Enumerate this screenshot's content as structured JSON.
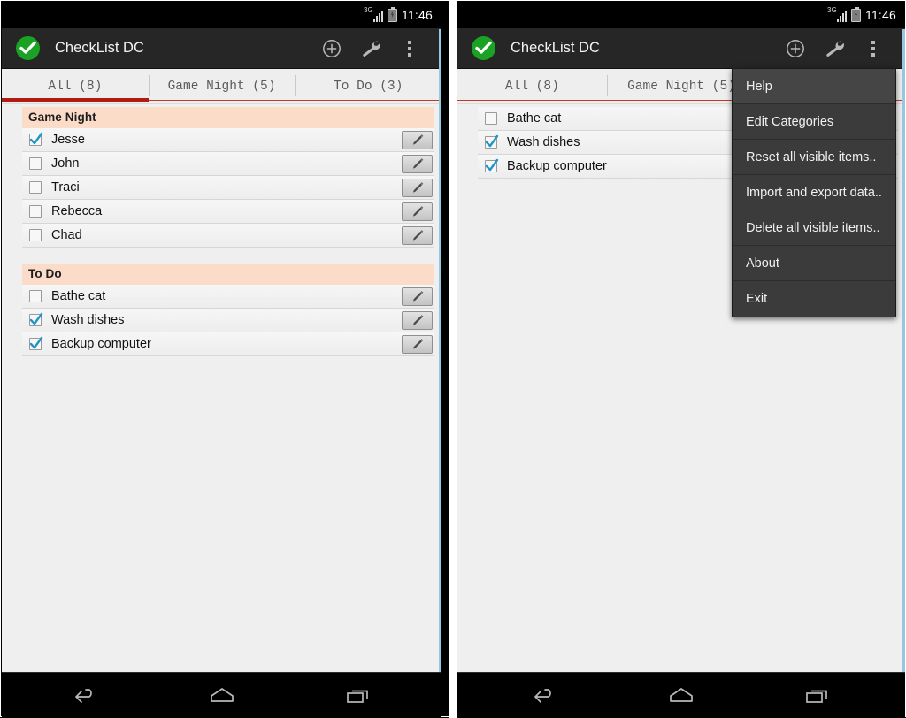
{
  "status_bar": {
    "network_label": "3G",
    "time": "11:46",
    "signal_icon": "signal-bars-icon",
    "battery_icon": "battery-charging-icon"
  },
  "action_bar": {
    "app_icon": "green-check-circle-icon",
    "title": "CheckList DC",
    "add_icon": "plus-circle-icon",
    "settings_icon": "wrench-icon",
    "overflow_icon": "three-dots-icon"
  },
  "tabs": [
    {
      "label": "All (8)",
      "active": true
    },
    {
      "label": "Game Night (5)",
      "active": false
    },
    {
      "label": "To Do (3)",
      "active": false
    }
  ],
  "tabs_right": [
    {
      "label": "All (8)",
      "active": false
    },
    {
      "label": "Game Night (5)",
      "active": false
    }
  ],
  "left_panel": {
    "sections": [
      {
        "title": "Game Night",
        "items": [
          {
            "label": "Jesse",
            "checked": true
          },
          {
            "label": "John",
            "checked": false
          },
          {
            "label": "Traci",
            "checked": false
          },
          {
            "label": "Rebecca",
            "checked": false
          },
          {
            "label": "Chad",
            "checked": false
          }
        ]
      },
      {
        "title": "To Do",
        "items": [
          {
            "label": "Bathe cat",
            "checked": false
          },
          {
            "label": "Wash dishes",
            "checked": true
          },
          {
            "label": "Backup computer",
            "checked": true
          }
        ]
      }
    ]
  },
  "right_panel": {
    "items": [
      {
        "label": "Bathe cat",
        "checked": false
      },
      {
        "label": "Wash dishes",
        "checked": true
      },
      {
        "label": "Backup computer",
        "checked": true
      }
    ]
  },
  "overflow_menu": {
    "items": [
      {
        "label": "Help"
      },
      {
        "label": "Edit Categories"
      },
      {
        "label": "Reset all visible items.."
      },
      {
        "label": "Import and export data.."
      },
      {
        "label": "Delete all visible items.."
      },
      {
        "label": "About"
      },
      {
        "label": "Exit"
      }
    ]
  },
  "nav_bar": {
    "back_icon": "back-arrow-icon",
    "home_icon": "home-icon",
    "recents_icon": "recent-apps-icon"
  },
  "colors": {
    "accent_red": "#b01b12",
    "category_header": "#fbdcc8",
    "app_green": "#19a224",
    "checkbox_blue": "#2196c4",
    "action_bar": "#262626",
    "menu_bg": "#3b3b3b"
  }
}
